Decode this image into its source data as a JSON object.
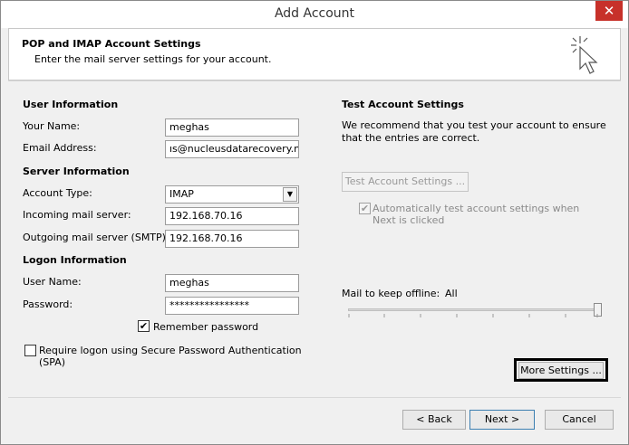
{
  "window": {
    "title": "Add Account",
    "close_glyph": "✕"
  },
  "header": {
    "title": "POP and IMAP Account Settings",
    "subtitle": "Enter the mail server settings for your account.",
    "icon": "magic-wand-cursor-icon"
  },
  "user_info": {
    "section": "User Information",
    "name_label": "Your Name:",
    "name_value": "meghas",
    "email_label": "Email Address:",
    "email_value": "ıs@nucleusdatarecovery.net"
  },
  "server_info": {
    "section": "Server Information",
    "account_type_label": "Account Type:",
    "account_type_value": "IMAP",
    "incoming_label": "Incoming mail server:",
    "incoming_value": "192.168.70.16",
    "outgoing_label": "Outgoing mail server (SMTP):",
    "outgoing_value": "192.168.70.16"
  },
  "logon_info": {
    "section": "Logon Information",
    "user_label": "User Name:",
    "user_value": "meghas",
    "password_label": "Password:",
    "password_value": "****************",
    "remember_label": "Remember password",
    "remember_checked": true,
    "spa_label": "Require logon using Secure Password Authentication (SPA)",
    "spa_checked": false
  },
  "test_settings": {
    "section": "Test Account Settings",
    "description": "We recommend that you test your account to ensure that the entries are correct.",
    "button": "Test Account Settings ...",
    "auto_test_label": "Automatically test account settings when Next is clicked",
    "auto_test_checked": true
  },
  "offline": {
    "label": "Mail to keep offline:",
    "value": "All",
    "slider_level": 1.0
  },
  "buttons": {
    "more_settings": "More Settings ...",
    "back": "< Back",
    "next": "Next >",
    "cancel": "Cancel"
  },
  "colors": {
    "close": "#c7312a",
    "primary_border": "#3c7fb1"
  }
}
